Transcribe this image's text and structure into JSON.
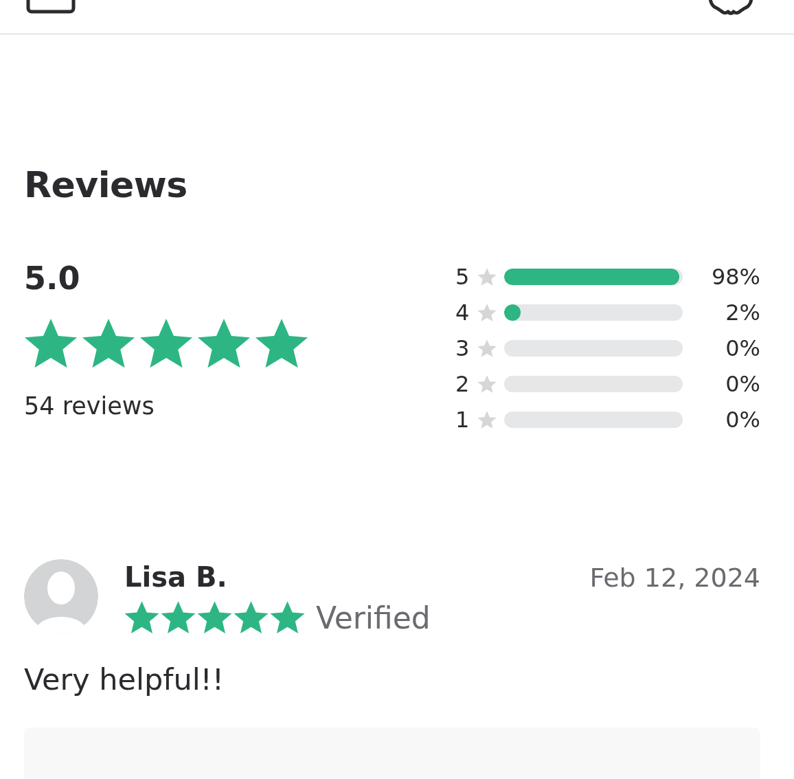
{
  "reviews": {
    "heading": "Reviews",
    "rating": "5.0",
    "stars": 5,
    "count": "54 reviews",
    "distribution": [
      {
        "label": "5",
        "level": 0.98,
        "percent": "98%"
      },
      {
        "label": "4",
        "level": 0.02,
        "percent": "2%"
      },
      {
        "label": "3",
        "level": 0,
        "percent": "0%"
      },
      {
        "label": "2",
        "level": 0,
        "percent": "0%"
      },
      {
        "label": "1",
        "level": 0,
        "percent": "0%"
      }
    ]
  },
  "review_list": [
    {
      "name": "Lisa B.",
      "date": "Feb 12, 2024",
      "stars": 5,
      "badge": "Verified",
      "text": "Very helpful!!"
    }
  ]
}
